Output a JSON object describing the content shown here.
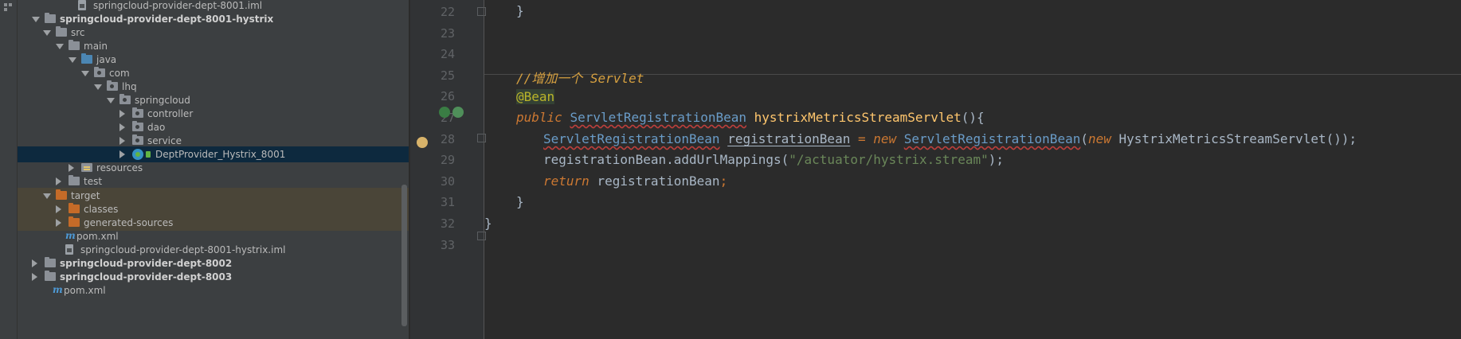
{
  "tree": {
    "items": [
      {
        "label": "springcloud-provider-dept-8001.iml",
        "icon": "file-icon",
        "toggle": "none",
        "indent": 62,
        "bold": false,
        "state": ""
      },
      {
        "label": "springcloud-provider-dept-8001-hystrix",
        "icon": "folder-icon",
        "toggle": "open",
        "indent": 20,
        "bold": true,
        "state": ""
      },
      {
        "label": "src",
        "icon": "folder-icon",
        "toggle": "open",
        "indent": 34,
        "bold": false,
        "state": ""
      },
      {
        "label": "main",
        "icon": "folder-icon",
        "toggle": "open",
        "indent": 50,
        "bold": false,
        "state": ""
      },
      {
        "label": "java",
        "icon": "source-folder-icon",
        "toggle": "open",
        "indent": 66,
        "bold": false,
        "state": ""
      },
      {
        "label": "com",
        "icon": "package-icon",
        "toggle": "open",
        "indent": 82,
        "bold": false,
        "state": ""
      },
      {
        "label": "lhq",
        "icon": "package-icon",
        "toggle": "open",
        "indent": 98,
        "bold": false,
        "state": ""
      },
      {
        "label": "springcloud",
        "icon": "package-icon",
        "toggle": "open",
        "indent": 114,
        "bold": false,
        "state": ""
      },
      {
        "label": "controller",
        "icon": "package-icon",
        "toggle": "closed",
        "indent": 130,
        "bold": false,
        "state": ""
      },
      {
        "label": "dao",
        "icon": "package-icon",
        "toggle": "closed",
        "indent": 130,
        "bold": false,
        "state": ""
      },
      {
        "label": "service",
        "icon": "package-icon",
        "toggle": "closed",
        "indent": 130,
        "bold": false,
        "state": ""
      },
      {
        "label": "DeptProvider_Hystrix_8001",
        "icon": "spring-boot-class-icon",
        "toggle": "closed",
        "indent": 130,
        "bold": false,
        "state": "selected"
      },
      {
        "label": "resources",
        "icon": "resources-folder-icon",
        "toggle": "closed",
        "indent": 66,
        "bold": false,
        "state": ""
      },
      {
        "label": "test",
        "icon": "folder-icon",
        "toggle": "closed",
        "indent": 50,
        "bold": false,
        "state": ""
      },
      {
        "label": "target",
        "icon": "excluded-folder-icon",
        "toggle": "open",
        "indent": 34,
        "bold": false,
        "state": "highlight"
      },
      {
        "label": "classes",
        "icon": "excluded-folder-icon",
        "toggle": "closed",
        "indent": 50,
        "bold": false,
        "state": "highlight"
      },
      {
        "label": "generated-sources",
        "icon": "excluded-folder-icon",
        "toggle": "closed",
        "indent": 50,
        "bold": false,
        "state": "highlight"
      },
      {
        "label": "pom.xml",
        "icon": "maven-icon",
        "toggle": "none",
        "indent": 46,
        "bold": false,
        "state": ""
      },
      {
        "label": "springcloud-provider-dept-8001-hystrix.iml",
        "icon": "file-icon",
        "toggle": "none",
        "indent": 46,
        "bold": false,
        "state": ""
      },
      {
        "label": "springcloud-provider-dept-8002",
        "icon": "folder-icon",
        "toggle": "closed",
        "indent": 20,
        "bold": true,
        "state": ""
      },
      {
        "label": "springcloud-provider-dept-8003",
        "icon": "folder-icon",
        "toggle": "closed",
        "indent": 20,
        "bold": true,
        "state": ""
      },
      {
        "label": "pom.xml",
        "icon": "maven-icon",
        "toggle": "none",
        "indent": 30,
        "bold": false,
        "state": ""
      }
    ]
  },
  "editor": {
    "line_numbers": [
      "22",
      "23",
      "24",
      "25",
      "26",
      "27",
      "28",
      "29",
      "30",
      "31",
      "32",
      "33"
    ],
    "code": {
      "l22": "}",
      "l25_comment": "//增加一个 Servlet",
      "l26_annotation": "@Bean",
      "l27_public": "public",
      "l27_type": "ServletRegistrationBean",
      "l27_method": "hystrixMetricsStreamServlet",
      "l27_rest": "(){",
      "l28_type": "ServletRegistrationBean",
      "l28_var": "registrationBean",
      "l28_eq": " = ",
      "l28_new": "new",
      "l28_ctor": "ServletRegistrationBean",
      "l28_paren": "(",
      "l28_new2": "new",
      "l28_arg": "HystrixMetricsStreamServlet",
      "l28_end": "());",
      "l29_obj": "registrationBean",
      "l29_dot": ".",
      "l29_method": "addUrlMappings",
      "l29_open": "(",
      "l29_str": "\"/actuator/hystrix.stream\"",
      "l29_close": ");",
      "l30_return": "return",
      "l30_var": "registrationBean",
      "l30_semi": ";",
      "l31": "}",
      "l32": "}"
    }
  },
  "colors": {
    "keyword": "#cc7832",
    "string": "#6a8759",
    "comment": "#d6a040",
    "annotation": "#bbb529",
    "selection": "#0d293e"
  }
}
